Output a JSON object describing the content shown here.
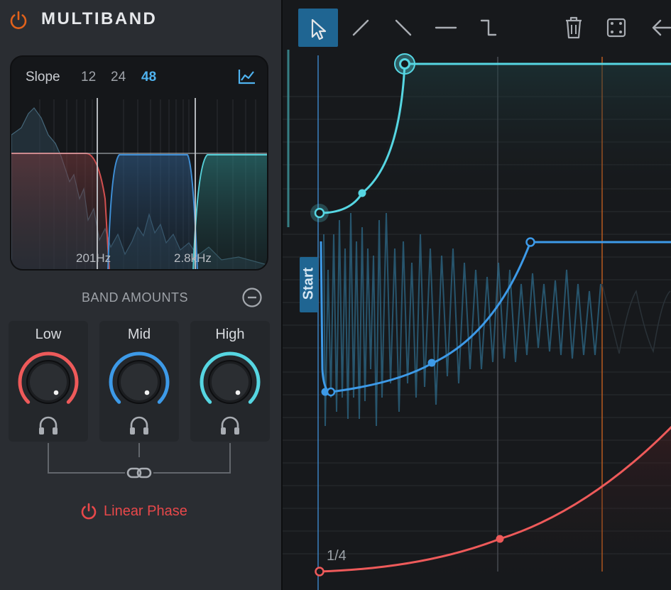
{
  "header": {
    "title": "MULTIBAND",
    "power_icon": "power-icon",
    "accent": "#e2621b"
  },
  "crossover": {
    "slope_label": "Slope",
    "slope_options": [
      "12",
      "24",
      "48"
    ],
    "selected_slope": "48",
    "spectrum_icon": "spectrum-chart-icon",
    "frequencies": [
      "201Hz",
      "2.8kHz"
    ]
  },
  "band_amounts": {
    "title": "BAND AMOUNTS",
    "collapse_icon": "minus-circle-icon",
    "bands": [
      {
        "name": "Low",
        "color": "#ee5a5a",
        "solo_icon": "headphones-icon"
      },
      {
        "name": "Mid",
        "color": "#3d9ae8",
        "solo_icon": "headphones-icon"
      },
      {
        "name": "High",
        "color": "#56d6e2",
        "solo_icon": "headphones-icon"
      }
    ],
    "link_icon": "link-icon"
  },
  "linear_phase": {
    "label": "Linear Phase",
    "icon": "power-icon",
    "color": "#e8484a"
  },
  "toolbar": {
    "tools": [
      "select-pointer-icon",
      "ramp-up-icon",
      "ramp-down-icon",
      "flat-line-icon",
      "step-icon",
      "trash-icon",
      "dice-icon",
      "arrow-left-icon"
    ],
    "active": "select-pointer-icon"
  },
  "editor": {
    "start_label": "Start",
    "grid_label": "1/4",
    "colors": {
      "high": "#56d6e2",
      "mid": "#3d9ae8",
      "low": "#ee5a5a",
      "marker": "#d9682a"
    }
  }
}
